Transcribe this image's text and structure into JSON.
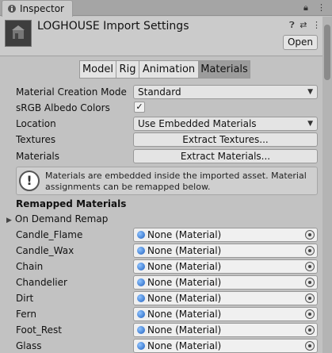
{
  "window": {
    "tab_title": "Inspector",
    "title": "LOGHOUSE Import Settings",
    "open_button": "Open",
    "header_icons": [
      "help-icon",
      "settings-sliders-icon",
      "more-menu-icon"
    ]
  },
  "tabs": [
    {
      "label": "Model",
      "active": false
    },
    {
      "label": "Rig",
      "active": false
    },
    {
      "label": "Animation",
      "active": false
    },
    {
      "label": "Materials",
      "active": true
    }
  ],
  "fields": {
    "material_creation_mode_label": "Material Creation Mode",
    "material_creation_mode_value": "Standard",
    "srgb_label": "sRGB Albedo Colors",
    "srgb_checked": true,
    "location_label": "Location",
    "location_value": "Use Embedded Materials",
    "textures_label": "Textures",
    "textures_button": "Extract Textures...",
    "materials_label": "Materials",
    "materials_button": "Extract Materials..."
  },
  "help": {
    "text": "Materials are embedded inside the imported asset. Material assignments can be remapped below."
  },
  "remapped": {
    "title": "Remapped Materials",
    "on_demand": "On Demand Remap",
    "items": [
      {
        "name": "Candle_Flame",
        "value": "None (Material)"
      },
      {
        "name": "Candle_Wax",
        "value": "None (Material)"
      },
      {
        "name": "Chain",
        "value": "None (Material)"
      },
      {
        "name": "Chandelier",
        "value": "None (Material)"
      },
      {
        "name": "Dirt",
        "value": "None (Material)"
      },
      {
        "name": "Fern",
        "value": "None (Material)"
      },
      {
        "name": "Foot_Rest",
        "value": "None (Material)"
      },
      {
        "name": "Glass",
        "value": "None (Material)"
      }
    ]
  }
}
